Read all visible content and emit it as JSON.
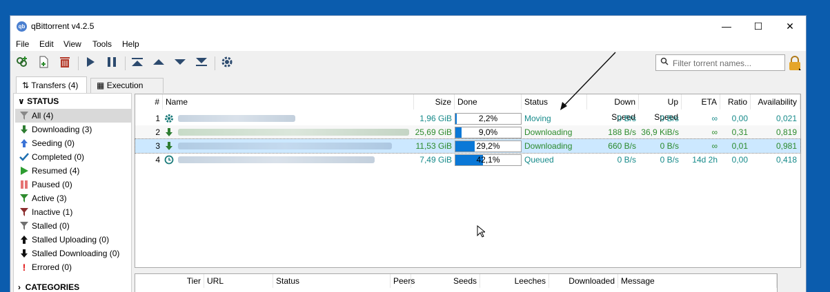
{
  "window": {
    "title": "qBittorrent v4.2.5",
    "app_icon": "qb"
  },
  "menu": [
    "File",
    "Edit",
    "View",
    "Tools",
    "Help"
  ],
  "search": {
    "placeholder": "Filter torrent names..."
  },
  "tabs": {
    "transfers": "Transfers (4)",
    "log": "Execution Log"
  },
  "sidebar": {
    "status_header": "STATUS",
    "categories_header": "CATEGORIES",
    "items": [
      "All (4)",
      "Downloading (3)",
      "Seeding (0)",
      "Completed (0)",
      "Resumed (4)",
      "Paused (0)",
      "Active (3)",
      "Inactive (1)",
      "Stalled (0)",
      "Stalled Uploading (0)",
      "Stalled Downloading (0)",
      "Errored (0)"
    ]
  },
  "columns": [
    "#",
    "Name",
    "Size",
    "Done",
    "Status",
    "Down Speed",
    "Up Speed",
    "ETA",
    "Ratio",
    "Availability"
  ],
  "torrents": [
    {
      "num": "1",
      "size": "1,96 GiB",
      "done": "2,2%",
      "done_frac": 0.022,
      "status": "Moving",
      "down": "0 B/s",
      "up": "0 B/s",
      "eta": "∞",
      "ratio": "0,00",
      "avail": "0,021"
    },
    {
      "num": "2",
      "size": "25,69 GiB",
      "done": "9,0%",
      "done_frac": 0.09,
      "status": "Downloading",
      "down": "188 B/s",
      "up": "36,9 KiB/s",
      "eta": "∞",
      "ratio": "0,31",
      "avail": "0,819"
    },
    {
      "num": "3",
      "size": "11,53 GiB",
      "done": "29,2%",
      "done_frac": 0.292,
      "status": "Downloading",
      "down": "660 B/s",
      "up": "0 B/s",
      "eta": "∞",
      "ratio": "0,01",
      "avail": "0,981"
    },
    {
      "num": "4",
      "size": "7,49 GiB",
      "done": "42,1%",
      "done_frac": 0.421,
      "status": "Queued",
      "down": "0 B/s",
      "up": "0 B/s",
      "eta": "14d 2h",
      "ratio": "0,00",
      "avail": "0,418"
    }
  ],
  "tracker_columns": [
    "Tier",
    "URL",
    "Status",
    "Peers",
    "Seeds",
    "Leeches",
    "Downloaded",
    "Message"
  ]
}
